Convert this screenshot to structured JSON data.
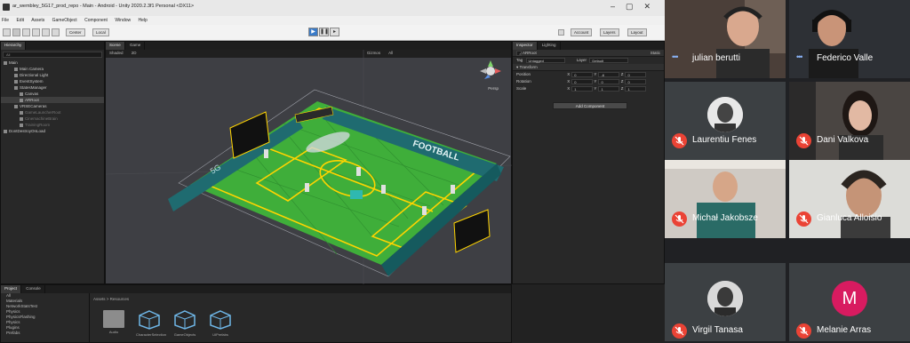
{
  "unity": {
    "title": "ar_wembley_5G17_prod_repo - Main - Android - Unity 2020.2.3f1 Personal <DX11>",
    "menu": [
      "File",
      "Edit",
      "Assets",
      "GameObject",
      "Component",
      "Window",
      "Help"
    ],
    "toolbar": {
      "center": "Center",
      "local": "Local",
      "account": "Account",
      "layers": "Layers",
      "layout": "Layout"
    },
    "hierarchy": {
      "tab": "Hierarchy",
      "search_placeholder": "All",
      "rows": [
        {
          "label": "Main",
          "indent": 0,
          "dim": false,
          "selected": false
        },
        {
          "label": "Main Camera",
          "indent": 2,
          "dim": false,
          "selected": false
        },
        {
          "label": "Directional Light",
          "indent": 2,
          "dim": false,
          "selected": false
        },
        {
          "label": "EventSystem",
          "indent": 2,
          "dim": false,
          "selected": false
        },
        {
          "label": "StatesManager",
          "indent": 2,
          "dim": false,
          "selected": false
        },
        {
          "label": "Canvas",
          "indent": 3,
          "dim": false,
          "selected": false
        },
        {
          "label": "ARRoot",
          "indent": 3,
          "dim": false,
          "selected": true
        },
        {
          "label": "VRSECameras",
          "indent": 2,
          "dim": false,
          "selected": false
        },
        {
          "label": "GameLauncherRoot",
          "indent": 3,
          "dim": true,
          "selected": false
        },
        {
          "label": "CinemachineBrain",
          "indent": 3,
          "dim": true,
          "selected": false
        },
        {
          "label": "TrainingRoom",
          "indent": 3,
          "dim": true,
          "selected": false
        },
        {
          "label": "DontDestroyOnLoad",
          "indent": 0,
          "dim": false,
          "selected": false
        }
      ]
    },
    "scene": {
      "tabs": [
        "Scene",
        "Game"
      ],
      "shading": "Shaded",
      "mode": "2D",
      "gizmos": "Gizmos",
      "search": "All",
      "view": "Persp",
      "banner_text": "5G FOOTBALL",
      "banner_small": "5G",
      "ad_text": "FOOTBALL"
    },
    "inspector": {
      "tabs": [
        "Inspector",
        "Lighting"
      ],
      "object_name": "ARRoot",
      "static_label": "Static",
      "tag_label": "Tag",
      "tag_value": "Untagged",
      "layer_label": "Layer",
      "layer_value": "Default",
      "component": "Transform",
      "position_label": "Position",
      "rotation_label": "Rotation",
      "scale_label": "Scale",
      "position": [
        "0",
        "-6",
        "0"
      ],
      "rotation": [
        "0",
        "0",
        "0"
      ],
      "scale": [
        "1",
        "1",
        "1"
      ],
      "add_component": "Add Component"
    },
    "project": {
      "tabs": [
        "Project",
        "Console"
      ],
      "tree": [
        "All",
        "Materials",
        "NetworkStatsTest",
        "Physics",
        "PhysicsFlashing",
        "Physics",
        "Plugins",
        "Prefabs"
      ],
      "breadcrumb": "Assets > Resources",
      "assets": [
        "Audio",
        "CharacterSelection",
        "GameObjects",
        "UIPrefabs"
      ]
    }
  },
  "meet": {
    "participants": [
      {
        "name": "julian berutti",
        "muted": false,
        "speaking": true
      },
      {
        "name": "Federico Valle",
        "muted": false,
        "speaking": true
      },
      {
        "name": "Laurentiu Fenes",
        "muted": true,
        "speaking": false
      },
      {
        "name": "Dani Valkova",
        "muted": true,
        "speaking": false
      },
      {
        "name": "Michał Jakobsze",
        "muted": true,
        "speaking": false
      },
      {
        "name": "Gianluca Alloisio",
        "muted": true,
        "speaking": false
      },
      {
        "name": "Virgil Tanasa",
        "muted": true,
        "speaking": false
      },
      {
        "name": "Melanie Arras",
        "muted": true,
        "speaking": false,
        "initial": "M"
      }
    ]
  },
  "colors": {
    "muted_red": "#ea4335",
    "speaking_blue": "#8ab4f8",
    "pitch_green": "#3fae3a",
    "line_yellow": "#ffd400",
    "avatar_pink": "#d81b60"
  }
}
